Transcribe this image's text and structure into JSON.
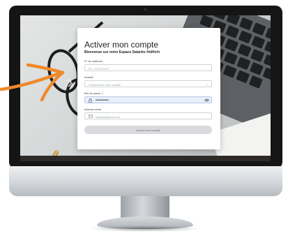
{
  "form": {
    "title": "Activer mon compte",
    "subtitle": "Bienvenue sur notre Espace Salariés Holfrich",
    "fields": [
      {
        "label": "N° de matricule",
        "placeholder": "Ex : XXXXXXXX"
      },
      {
        "label": "Société",
        "placeholder": "Sélectionner votre société"
      },
      {
        "label": "Mot de passe ⓘ",
        "value": "••••••••••••"
      },
      {
        "label": "Adresse email",
        "placeholder": "example@mail.com"
      }
    ],
    "submit_label": "Activer mon compte"
  },
  "icons": {
    "password_field_icon": "lock-icon",
    "show_password_icon": "eye-icon",
    "email_field_icon": "envelope-icon",
    "company_dropdown_icon": "chevron-down-icon"
  },
  "colors": {
    "arrow": "#ef8a2c",
    "bezel": "#151515",
    "password_field_bg": "#e8effc",
    "submit_button_bg": "#d9dadd"
  }
}
